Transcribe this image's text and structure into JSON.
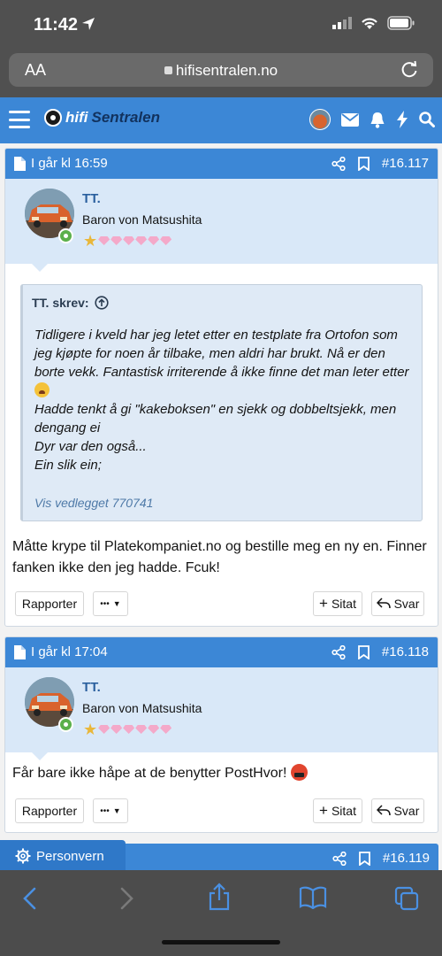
{
  "status_bar": {
    "time": "11:42"
  },
  "browser": {
    "aa_label": "AA",
    "url": "hifisentralen.no"
  },
  "site": {
    "logo_part1": "hifi",
    "logo_part2": "Sentralen"
  },
  "posts": [
    {
      "date": "I går kl 16:59",
      "number": "#16.117",
      "username": "TT.",
      "user_title": "Baron von Matsushita",
      "quote": {
        "author": "TT. skrev:",
        "lines": [
          "Tidligere i kveld har jeg letet etter en testplate fra Ortofon som jeg kjøpte for noen år tilbake, men aldri har brukt. Nå er den borte vekk. Fantastisk irriterende å ikke finne det man leter etter",
          "Hadde tenkt å gi \"kakeboksen\" en sjekk og dobbeltsjekk, men dengang ei",
          "Dyr var den også...",
          "Ein slik ein;"
        ],
        "attachment_link": "Vis vedlegget 770741"
      },
      "text": "Måtte krype til Platekompaniet.no og bestille meg en ny en. Finner fanken ikke den jeg hadde. Fcuk!",
      "report_label": "Rapporter",
      "more_label": "•••",
      "quote_label": "Sitat",
      "reply_label": "Svar"
    },
    {
      "date": "I går kl 17:04",
      "number": "#16.118",
      "username": "TT.",
      "user_title": "Baron von Matsushita",
      "text": "Får bare ikke håpe at de benytter PostHvor!",
      "report_label": "Rapporter",
      "more_label": "•••",
      "quote_label": "Sitat",
      "reply_label": "Svar"
    },
    {
      "number": "#16.119"
    }
  ],
  "privacy_label": "Personvern",
  "colors": {
    "header_blue": "#3c87d6",
    "user_block": "#d9e8f8",
    "quote_bg": "#dfeaf6",
    "username": "#2a5f9e",
    "ios_gray": "#505050"
  }
}
